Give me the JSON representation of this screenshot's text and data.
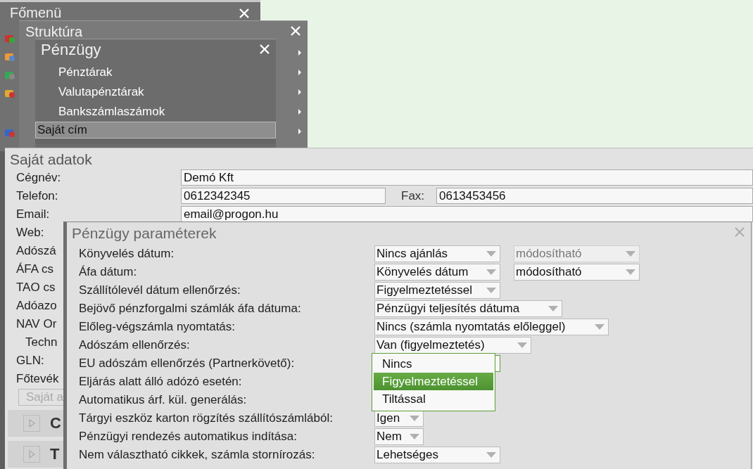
{
  "main_menu": {
    "title": "Főmenü"
  },
  "structure_window": {
    "title": "Struktúra"
  },
  "finance_menu": {
    "title": "Pénzügy",
    "items": [
      {
        "label": "Pénztárak",
        "selected": false
      },
      {
        "label": "Valutapénztárak",
        "selected": false
      },
      {
        "label": "Bankszámlaszámok",
        "selected": false
      },
      {
        "label": "Saját cím",
        "selected": true
      }
    ]
  },
  "company_window": {
    "title": "Saját adatok",
    "fields": [
      {
        "label": "Cégnév:",
        "value": "Demó Kft"
      },
      {
        "label": "Telefon:",
        "value": "0612342345",
        "extra_label": "Fax:",
        "extra_value": "0613453456"
      },
      {
        "label": "Email:",
        "value": "email@progon.hu"
      },
      {
        "label": "Web:"
      },
      {
        "label": "Adószá"
      },
      {
        "label": "ÁFA cs"
      },
      {
        "label": "TAO cs"
      },
      {
        "label": "Adóazo"
      },
      {
        "label": "NAV Or"
      },
      {
        "label": "Techn",
        "indented": true
      },
      {
        "label": "GLN:"
      },
      {
        "label": "Főtevék"
      }
    ],
    "button": "Saját a",
    "sections": [
      {
        "title": "C"
      },
      {
        "title": "T"
      }
    ]
  },
  "params_window": {
    "title": "Pénzügy paraméterek",
    "rows": [
      {
        "label": "Könyvelés dátum:",
        "selects": [
          {
            "value": "Nincs ajánlás",
            "disabled": false
          },
          {
            "value": "módosítható",
            "disabled": true
          }
        ]
      },
      {
        "label": "Áfa dátum:",
        "selects": [
          {
            "value": "Könyvelés dátum",
            "disabled": false
          },
          {
            "value": "módosítható",
            "disabled": false
          }
        ]
      },
      {
        "label": "Szállítólevél dátum ellenőrzés:",
        "selects": [
          {
            "value": "Figyelmeztetéssel",
            "disabled": false
          }
        ]
      },
      {
        "label": "Bejövő pénzforgalmi számlák áfa dátuma:",
        "selects": [
          {
            "value": "Pénzügyi teljesítés dátuma",
            "disabled": false
          }
        ]
      },
      {
        "label": "Előleg-végszámla nyomtatás:",
        "selects": [
          {
            "value": "Nincs (számla nyomtatás előleggel)",
            "disabled": false
          }
        ]
      },
      {
        "label": "Adószám ellenőrzés:",
        "selects": [
          {
            "value": "Van (figyelmeztetés)",
            "disabled": false
          }
        ]
      },
      {
        "label": "EU adószám ellenőrzés (Partnerkövető):",
        "dropdown": {
          "options": [
            {
              "label": "Nincs",
              "selected": false
            },
            {
              "label": "Figyelmeztetéssel",
              "selected": true
            },
            {
              "label": "Tiltással",
              "selected": false
            }
          ]
        }
      },
      {
        "label": "Eljárás alatt álló adózó esetén:"
      },
      {
        "label": "Automatikus árf. kül. generálás:"
      },
      {
        "label": "Tárgyi eszköz karton rögzítés szállítószámlából:",
        "selects": [
          {
            "value": "Igen",
            "disabled": false
          }
        ]
      },
      {
        "label": "Pénzügyi rendezés automatikus indítása:",
        "selects": [
          {
            "value": "Nem",
            "disabled": false
          }
        ]
      },
      {
        "label": "Nem választható cikkek, számla stornírozás:",
        "selects": [
          {
            "value": "Lehetséges",
            "disabled": false
          }
        ]
      }
    ]
  }
}
